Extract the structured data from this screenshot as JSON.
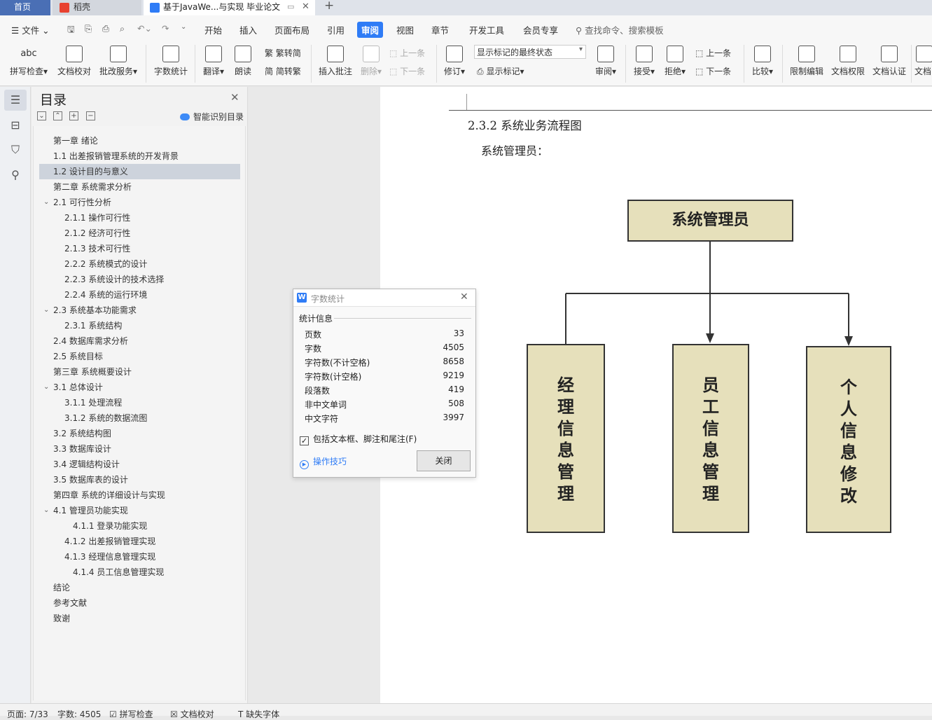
{
  "tabs": {
    "home": "首页",
    "daoke": "稻壳",
    "doc": "基于JavaWe...与实现 毕业论文"
  },
  "menu": {
    "file": "文件",
    "items": [
      "开始",
      "插入",
      "页面布局",
      "引用",
      "审阅",
      "视图",
      "章节",
      "开发工具",
      "会员专享"
    ],
    "search": "查找命令、搜索模板"
  },
  "ribbon": {
    "spell": "拼写检查",
    "proof": "文档校对",
    "batch": "批改服务",
    "wordcount": "字数统计",
    "translate": "翻译",
    "read": "朗读",
    "trad": "繁转简",
    "simp": "简转繁",
    "comment": "插入批注",
    "delete": "删除",
    "prev_c": "上一条",
    "next_c": "下一条",
    "revise": "修订",
    "markup_state": "显示标记的最终状态",
    "show_markup": "显示标记",
    "review": "审阅",
    "accept": "接受",
    "reject": "拒绝",
    "prev": "上一条",
    "next": "下一条",
    "compare": "比较",
    "restrict": "限制编辑",
    "perm": "文档权限",
    "cert": "文档认证",
    "more": "文档"
  },
  "toc": {
    "title": "目录",
    "smart": "智能识别目录",
    "items": [
      {
        "t": "第一章  绪论"
      },
      {
        "t": "1.1  出差报销管理系统的开发背景"
      },
      {
        "t": "1.2 设计目的与意义"
      },
      {
        "t": "第二章  系统需求分析"
      },
      {
        "t": "2.1  可行性分析"
      },
      {
        "t": "2.1.1  操作可行性"
      },
      {
        "t": "2.1.2  经济可行性"
      },
      {
        "t": "2.1.3  技术可行性"
      },
      {
        "t": "2.2.2  系统模式的设计"
      },
      {
        "t": "2.2.3 系统设计的技术选择"
      },
      {
        "t": "2.2.4 系统的运行环境"
      },
      {
        "t": "2.3  系统基本功能需求"
      },
      {
        "t": "2.3.1  系统结构"
      },
      {
        "t": "2.4  数据库需求分析"
      },
      {
        "t": "2.5  系统目标"
      },
      {
        "t": "第三章  系统概要设计"
      },
      {
        "t": "3.1 总体设计"
      },
      {
        "t": "3.1.1  处理流程"
      },
      {
        "t": "3.1.2 系统的数据流图"
      },
      {
        "t": "3.2  系统结构图"
      },
      {
        "t": "3.3 数据库设计"
      },
      {
        "t": "3.4 逻辑结构设计"
      },
      {
        "t": "3.5 数据库表的设计"
      },
      {
        "t": "第四章  系统的详细设计与实现"
      },
      {
        "t": "4.1  管理员功能实现"
      },
      {
        "t": "4.1.1  登录功能实现"
      },
      {
        "t": "4.1.2  出差报销管理实现"
      },
      {
        "t": "4.1.3  经理信息管理实现"
      },
      {
        "t": "4.1.4  员工信息管理实现"
      },
      {
        "t": "结论"
      },
      {
        "t": "参考文献"
      },
      {
        "t": "致谢"
      }
    ]
  },
  "doc": {
    "section_title": "2.3.2  系统业务流程图",
    "subtitle": "系统管理员：",
    "flow": {
      "root": "系统管理员",
      "a": "经理信息管理",
      "b": "员工信息管理",
      "c": "个人信息修改"
    }
  },
  "dialog": {
    "title": "字数统计",
    "section": "统计信息",
    "rows": [
      {
        "k": "页数",
        "v": "33"
      },
      {
        "k": "字数",
        "v": "4505"
      },
      {
        "k": "字符数(不计空格)",
        "v": "8658"
      },
      {
        "k": "字符数(计空格)",
        "v": "9219"
      },
      {
        "k": "段落数",
        "v": "419"
      },
      {
        "k": "非中文单词",
        "v": "508"
      },
      {
        "k": "中文字符",
        "v": "3997"
      }
    ],
    "checkbox": "包括文本框、脚注和尾注(F)",
    "tips": "操作技巧",
    "close": "关闭"
  },
  "status": {
    "page": "页面: 7/33",
    "words": "字数: 4505",
    "spell": "拼写检查",
    "proof": "文档校对",
    "font": "缺失字体"
  },
  "colors": {
    "accent": "#2f7cf6",
    "box_fill": "#e6e0bb"
  }
}
